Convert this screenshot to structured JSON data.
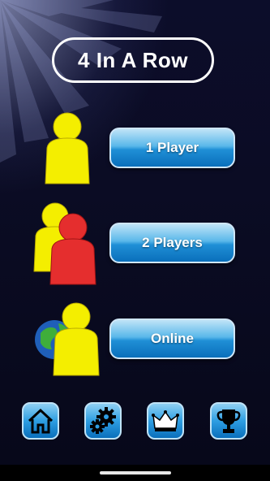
{
  "app": {
    "title": "4 In A Row"
  },
  "menu": {
    "one_player": "1 Player",
    "two_players": "2 Players",
    "online": "Online"
  },
  "icons": {
    "one_player": "yellow-person-icon",
    "two_players": "yellow-red-persons-icon",
    "online": "globe-person-icon",
    "home": "home-icon",
    "settings": "gears-icon",
    "crown": "crown-icon",
    "trophy": "trophy-icon"
  },
  "colors": {
    "background": "#0b0c24",
    "button": "#1f8fd6",
    "player_yellow": "#f4ee00",
    "player_red": "#e52e2e"
  }
}
